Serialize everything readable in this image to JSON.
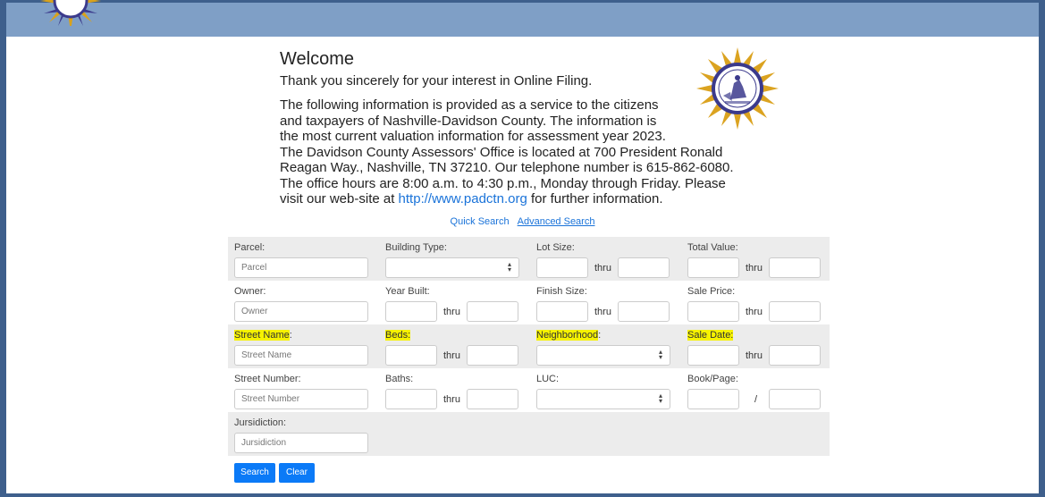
{
  "header": {
    "logo": "county-seal-logo"
  },
  "intro": {
    "title": "Welcome",
    "line1": "Thank you sincerely for your interest in Online Filing.",
    "para_lines": [
      "The following information is provided as a service to the citizens",
      "and taxpayers of Nashville-Davidson County. The information is",
      "the most current valuation information for assessment year 2023.",
      "The Davidson County Assessors' Office is located at 700 President Ronald",
      "Reagan Way., Nashville, TN 37210. Our telephone number is 615-862-6080.",
      "The office hours are 8:00 a.m. to 4:30 p.m., Monday through Friday. Please"
    ],
    "last_prefix": "visit our web-site at ",
    "link_text": "http://www.padctn.org",
    "last_suffix": " for further information."
  },
  "search_links": {
    "quick": "Quick Search",
    "advanced": "Advanced Search"
  },
  "form": {
    "parcel": {
      "label": "Parcel:",
      "placeholder": "Parcel"
    },
    "building_type": {
      "label": "Building Type:"
    },
    "lot_size": {
      "label": "Lot Size:"
    },
    "total_value": {
      "label": "Total Value:"
    },
    "owner": {
      "label": "Owner:",
      "placeholder": "Owner"
    },
    "year_built": {
      "label": "Year Built:"
    },
    "finish_size": {
      "label": "Finish Size:"
    },
    "sale_price": {
      "label": "Sale Price:"
    },
    "street_name": {
      "label": "Street Name",
      "suffix": ":",
      "placeholder": "Street Name"
    },
    "beds": {
      "label": "Beds:"
    },
    "neighborhood": {
      "label": "Neighborhood",
      "suffix": ":"
    },
    "sale_date": {
      "label": "Sale Date:"
    },
    "street_number": {
      "label": "Street Number:",
      "placeholder": "Street Number"
    },
    "baths": {
      "label": "Baths:"
    },
    "luc": {
      "label": "LUC:"
    },
    "book_page": {
      "label": "Book/Page:",
      "separator": "/"
    },
    "jurisdiction": {
      "label": "Jursidiction:",
      "placeholder": "Jursidiction"
    },
    "thru": "thru"
  },
  "buttons": {
    "search": "Search",
    "clear": "Clear"
  },
  "colors": {
    "accent": "#0b7af7",
    "header": "#7f9fc6",
    "frame": "#3e5f8c",
    "highlight": "#f6f200"
  }
}
